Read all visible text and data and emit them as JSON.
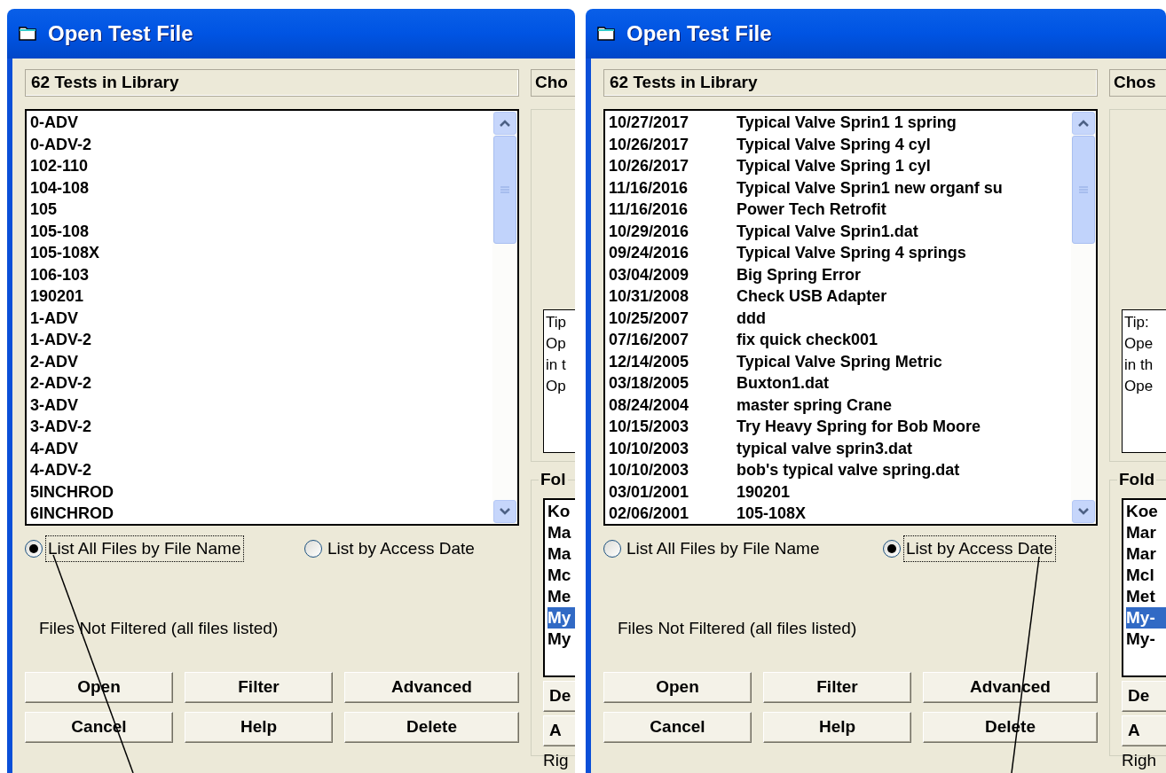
{
  "windows": [
    {
      "title": "Open Test File",
      "count_label": "62 Tests in Library",
      "chosen_header": "Cho",
      "files": [
        {
          "name": "0-ADV"
        },
        {
          "name": "0-ADV-2"
        },
        {
          "name": "102-110"
        },
        {
          "name": "104-108"
        },
        {
          "name": "105"
        },
        {
          "name": "105-108"
        },
        {
          "name": "105-108X"
        },
        {
          "name": "106-103"
        },
        {
          "name": "190201"
        },
        {
          "name": "1-ADV"
        },
        {
          "name": "1-ADV-2"
        },
        {
          "name": "2-ADV"
        },
        {
          "name": "2-ADV-2"
        },
        {
          "name": "3-ADV"
        },
        {
          "name": "3-ADV-2"
        },
        {
          "name": "4-ADV"
        },
        {
          "name": "4-ADV-2"
        },
        {
          "name": "5INCHROD"
        },
        {
          "name": "6INCHROD"
        }
      ],
      "sort_options": [
        {
          "label": "List All Files by File Name",
          "selected": true
        },
        {
          "label": "List by Access Date",
          "selected": false
        }
      ],
      "filter_status": "Files Not Filtered (all files listed)",
      "buttons": [
        "Open",
        "Filter",
        "Advanced",
        "Cancel",
        "Help",
        "Delete"
      ],
      "tip_lines": [
        "Tip",
        "Op",
        "in t",
        "Op"
      ],
      "folder_group": "Fol",
      "folders": [
        {
          "label": "Ko",
          "selected": false
        },
        {
          "label": "Ma",
          "selected": false
        },
        {
          "label": "Ma",
          "selected": false
        },
        {
          "label": "Mc",
          "selected": false
        },
        {
          "label": "Me",
          "selected": false
        },
        {
          "label": "My",
          "selected": true
        },
        {
          "label": "My",
          "selected": false
        }
      ],
      "folder_buttons": [
        "De",
        "A"
      ],
      "footer": "Rig"
    },
    {
      "title": "Open Test File",
      "count_label": "62 Tests in Library",
      "chosen_header": "Chos",
      "files": [
        {
          "date": "10/27/2017",
          "name": "Typical Valve Sprin1 1 spring"
        },
        {
          "date": "10/26/2017",
          "name": "Typical Valve Spring 4 cyl"
        },
        {
          "date": "10/26/2017",
          "name": "Typical Valve Spring 1 cyl"
        },
        {
          "date": "11/16/2016",
          "name": "Typical Valve Sprin1 new organf su"
        },
        {
          "date": "11/16/2016",
          "name": "Power Tech Retrofit"
        },
        {
          "date": "10/29/2016",
          "name": "Typical Valve Sprin1.dat"
        },
        {
          "date": "09/24/2016",
          "name": "Typical Valve Spring 4 springs"
        },
        {
          "date": "03/04/2009",
          "name": "Big Spring Error"
        },
        {
          "date": "10/31/2008",
          "name": "Check USB Adapter"
        },
        {
          "date": "10/25/2007",
          "name": "ddd"
        },
        {
          "date": "07/16/2007",
          "name": "fix quick check001"
        },
        {
          "date": "12/14/2005",
          "name": "Typical Valve Spring Metric"
        },
        {
          "date": "03/18/2005",
          "name": "Buxton1.dat"
        },
        {
          "date": "08/24/2004",
          "name": "master spring Crane"
        },
        {
          "date": "10/15/2003",
          "name": "Try Heavy Spring for Bob Moore"
        },
        {
          "date": "10/10/2003",
          "name": "typical valve sprin3.dat"
        },
        {
          "date": "10/10/2003",
          "name": "bob's typical valve spring.dat"
        },
        {
          "date": "03/01/2001",
          "name": "190201"
        },
        {
          "date": "02/06/2001",
          "name": "105-108X"
        }
      ],
      "sort_options": [
        {
          "label": "List All Files by File Name",
          "selected": false
        },
        {
          "label": "List by Access Date",
          "selected": true
        }
      ],
      "filter_status": "Files Not Filtered (all files listed)",
      "buttons": [
        "Open",
        "Filter",
        "Advanced",
        "Cancel",
        "Help",
        "Delete"
      ],
      "tip_lines": [
        "Tip:",
        "Ope",
        "in th",
        "Ope"
      ],
      "folder_group": "Fold",
      "folders": [
        {
          "label": "Koe",
          "selected": false
        },
        {
          "label": "Mar",
          "selected": false
        },
        {
          "label": "Mar",
          "selected": false
        },
        {
          "label": "Mcl",
          "selected": false
        },
        {
          "label": "Met",
          "selected": false
        },
        {
          "label": "My-",
          "selected": true
        },
        {
          "label": "My-",
          "selected": false
        }
      ],
      "folder_buttons": [
        "De",
        "A"
      ],
      "footer": "Righ"
    }
  ]
}
